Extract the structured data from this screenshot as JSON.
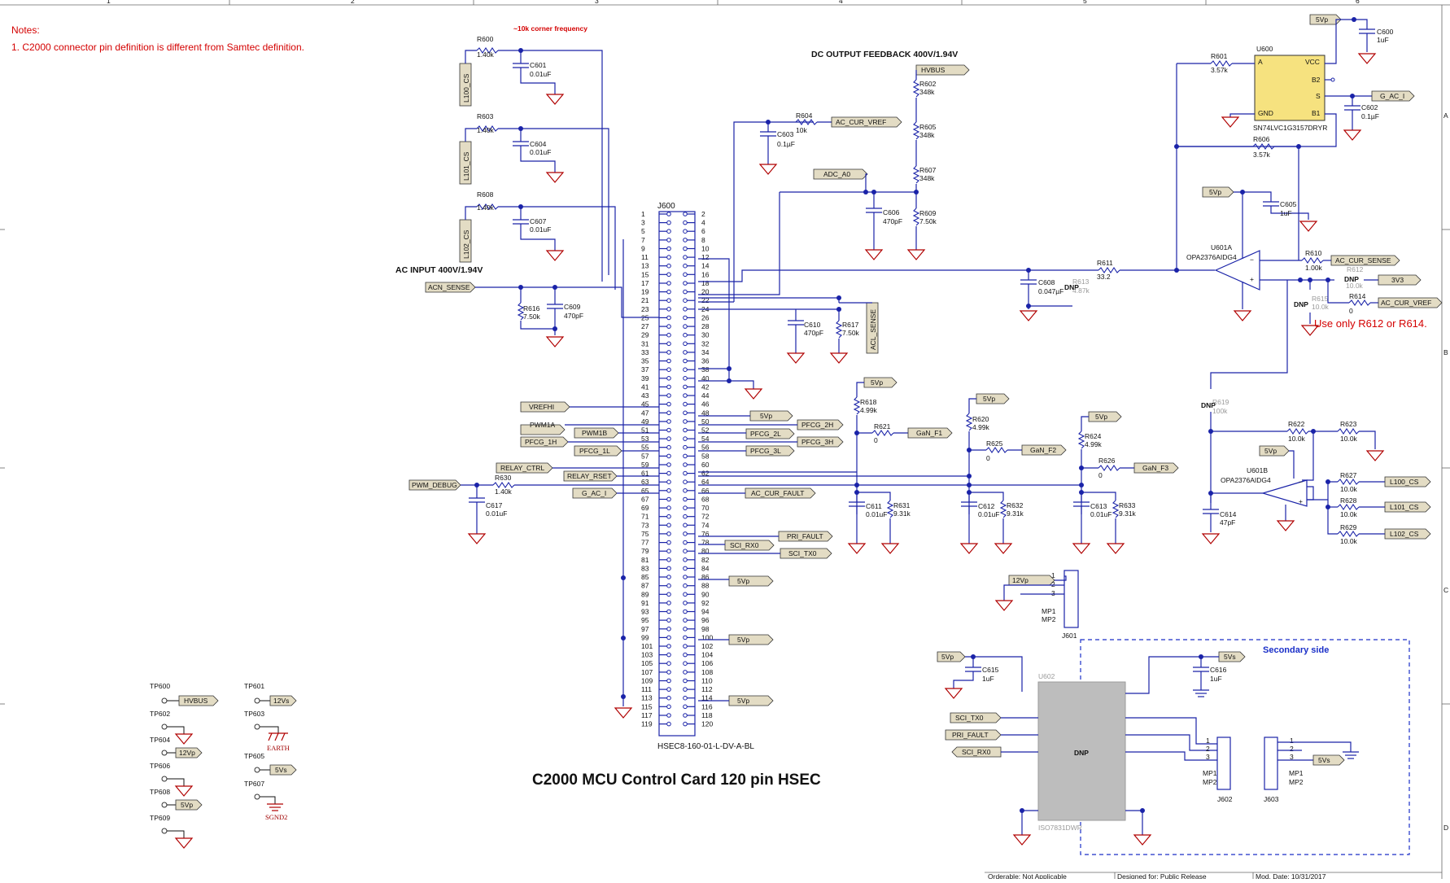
{
  "notes": {
    "heading": "Notes:",
    "line1": "1. C2000 connector pin definition is different from Samtec definition."
  },
  "border": {
    "cols": [
      "1",
      "2",
      "3",
      "4",
      "5",
      "6"
    ],
    "rows": [
      "A",
      "B",
      "C",
      "D"
    ]
  },
  "sections": {
    "corner_freq": "~10k corner frequency",
    "dc_output": "DC OUTPUT FEEDBACK 400V/1.94V",
    "ac_input": "AC INPUT 400V/1.94V",
    "use_only": "Use only R612 or R614.",
    "title": "C2000 MCU Control Card 120 pin HSEC",
    "secondary": "Secondary side"
  },
  "connector": {
    "ref": "J600",
    "part": "HSEC8-160-01-L-DV-A-BL"
  },
  "components": {
    "R600": {
      "ref": "R600",
      "val": "1.40k"
    },
    "C601": {
      "ref": "C601",
      "val": "0.01uF"
    },
    "R603": {
      "ref": "R603",
      "val": "1.40k"
    },
    "C604": {
      "ref": "C604",
      "val": "0.01uF"
    },
    "R608": {
      "ref": "R608",
      "val": "1.40k"
    },
    "C607": {
      "ref": "C607",
      "val": "0.01uF"
    },
    "R616": {
      "ref": "R616",
      "val": "7.50k"
    },
    "C609": {
      "ref": "C609",
      "val": "470pF"
    },
    "R604": {
      "ref": "R604",
      "val": "10k"
    },
    "C603": {
      "ref": "C603",
      "val": "0.1µF"
    },
    "R602": {
      "ref": "R602",
      "val": "348k"
    },
    "R605": {
      "ref": "R605",
      "val": "348k"
    },
    "R607": {
      "ref": "R607",
      "val": "348k"
    },
    "R609": {
      "ref": "R609",
      "val": "7.50k"
    },
    "C606": {
      "ref": "C606",
      "val": "470pF"
    },
    "C610": {
      "ref": "C610",
      "val": "470pF"
    },
    "R617": {
      "ref": "R617",
      "val": "7.50k"
    },
    "R630": {
      "ref": "R630",
      "val": "1.40k"
    },
    "C617": {
      "ref": "C617",
      "val": "0.01uF"
    },
    "R618": {
      "ref": "R618",
      "val": "4.99k"
    },
    "R621": {
      "ref": "R621",
      "val": "0"
    },
    "C611": {
      "ref": "C611",
      "val": "0.01uF"
    },
    "R631": {
      "ref": "R631",
      "val": "9.31k"
    },
    "R620": {
      "ref": "R620",
      "val": "4.99k"
    },
    "R625": {
      "ref": "R625",
      "val": "0"
    },
    "C612": {
      "ref": "C612",
      "val": "0.01uF"
    },
    "R632": {
      "ref": "R632",
      "val": "9.31k"
    },
    "R624": {
      "ref": "R624",
      "val": "4.99k"
    },
    "R626": {
      "ref": "R626",
      "val": "0"
    },
    "C613": {
      "ref": "C613",
      "val": "0.01uF"
    },
    "R633": {
      "ref": "R633",
      "val": "9.31k"
    },
    "C608": {
      "ref": "C608",
      "val": "0.047µF"
    },
    "R613": {
      "ref": "R613",
      "val": "4.87k"
    },
    "R611": {
      "ref": "R611",
      "val": "33.2"
    },
    "R610": {
      "ref": "R610",
      "val": "1.00k"
    },
    "R612": {
      "ref": "R612",
      "val": "10.0k"
    },
    "R615": {
      "ref": "R615",
      "val": "10.0k"
    },
    "R614": {
      "ref": "R614",
      "val": "0"
    },
    "R601": {
      "ref": "R601",
      "val": "3.57k"
    },
    "R606": {
      "ref": "R606",
      "val": "3.57k"
    },
    "C600": {
      "ref": "C600",
      "val": "1uF"
    },
    "C602": {
      "ref": "C602",
      "val": "0.1µF"
    },
    "C605": {
      "ref": "C605",
      "val": "1uF"
    },
    "R619": {
      "ref": "R619",
      "val": "100k"
    },
    "R622": {
      "ref": "R622",
      "val": "10.0k"
    },
    "R623": {
      "ref": "R623",
      "val": "10.0k"
    },
    "R627": {
      "ref": "R627",
      "val": "10.0k"
    },
    "R628": {
      "ref": "R628",
      "val": "10.0k"
    },
    "R629": {
      "ref": "R629",
      "val": "10.0k"
    },
    "C614": {
      "ref": "C614",
      "val": "47pF"
    },
    "C615": {
      "ref": "C615",
      "val": "1uF"
    },
    "C616": {
      "ref": "C616",
      "val": "1uF"
    }
  },
  "ics": {
    "U600": {
      "ref": "U600",
      "part": "SN74LVC1G3157DRYR",
      "pins": {
        "a": "A",
        "vcc": "VCC",
        "b2": "B2",
        "s": "S",
        "gnd": "GND",
        "b1": "B1"
      }
    },
    "U601A": {
      "ref": "U601A",
      "part": "OPA2376AIDG4"
    },
    "U601B": {
      "ref": "U601B",
      "part": "OPA2376AIDG4"
    },
    "U602": {
      "ref": "U602",
      "part": "ISO7831DWR",
      "dnp": "DNP"
    }
  },
  "dnp": "DNP",
  "nets": {
    "L100_CS": "L100_CS",
    "L101_CS": "L101_CS",
    "L102_CS": "L102_CS",
    "ACN_SENSE": "ACN_SENSE",
    "ACL_SENSE": "ACL_SENSE",
    "AC_CUR_VREF": "AC_CUR_VREF",
    "HVBUS": "HVBUS",
    "ADC_A0": "ADC_A0",
    "VREFHI": "VREFHI",
    "PWM1A": "PWM1A",
    "PWM1B": "PWM1B",
    "PFCG_1H": "PFCG_1H",
    "PFCG_1L": "PFCG_1L",
    "PFCG_2H": "PFCG_2H",
    "PFCG_2L": "PFCG_2L",
    "PFCG_3H": "PFCG_3H",
    "PFCG_3L": "PFCG_3L",
    "RELAY_CTRL": "RELAY_CTRL",
    "RELAY_RSET": "RELAY_RSET",
    "PWM_DEBUG": "PWM_DEBUG",
    "G_AC_I": "G_AC_I",
    "AC_CUR_FAULT": "AC_CUR_FAULT",
    "PRI_FAULT": "PRI_FAULT",
    "SCI_RX0": "SCI_RX0",
    "SCI_TX0": "SCI_TX0",
    "GaN_F1": "GaN_F1",
    "GaN_F2": "GaN_F2",
    "GaN_F3": "GaN_F3",
    "AC_CUR_SENSE": "AC_CUR_SENSE",
    "V3V3": "3V3",
    "V5Vp": "5Vp",
    "V12Vp": "12Vp",
    "V5Vs": "5Vs",
    "V12Vs": "12Vs",
    "EARTH": "EARTH",
    "SGND2": "SGND2"
  },
  "testpoints": [
    "TP600",
    "TP601",
    "TP602",
    "TP603",
    "TP604",
    "TP605",
    "TP606",
    "TP607",
    "TP608",
    "TP609"
  ],
  "j601": {
    "ref": "J601",
    "pins": [
      "1",
      "2",
      "3",
      "MP1",
      "MP2"
    ]
  },
  "j602": {
    "ref": "J602",
    "pins": [
      "1",
      "2",
      "3",
      "MP1",
      "MP2"
    ]
  },
  "j603": {
    "ref": "J603",
    "pins": [
      "1",
      "2",
      "3",
      "MP1",
      "MP2"
    ]
  },
  "footer": {
    "orderable": "Orderable: Not Applicable",
    "designed": "Designed for: Public Release",
    "mod_date": "Mod. Date: 10/31/2017"
  }
}
